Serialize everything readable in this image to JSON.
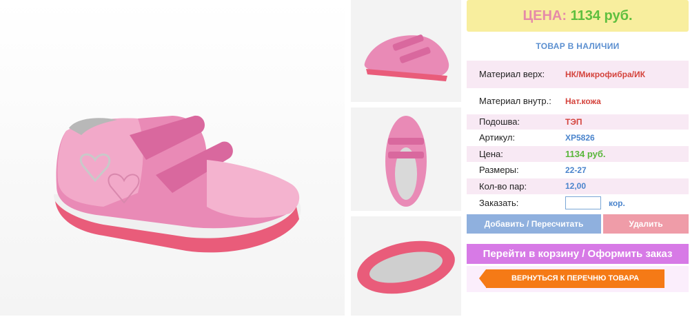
{
  "product": {
    "main_image": "pink-velcro-kids-sneaker-side-view",
    "thumbnails": [
      "sneaker-side-thumbnail",
      "sneaker-top-thumbnail",
      "sneaker-sole-thumbnail"
    ]
  },
  "price_box": {
    "label": "ЦЕНА:",
    "value": "1134 руб."
  },
  "stock_status": "ТОВАР В НАЛИЧИИ",
  "specs": {
    "upper_material": {
      "label": "Материал верх:",
      "value": "НК/Микрофибра/ИК"
    },
    "lining_material": {
      "label": "Материал внутр.:",
      "value": "Нат.кожа"
    },
    "sole": {
      "label": "Подошва:",
      "value": "ТЭП"
    },
    "article": {
      "label": "Артикул:",
      "value": "XP5826"
    },
    "price": {
      "label": "Цена:",
      "value": "1134 руб."
    },
    "sizes": {
      "label": "Размеры:",
      "value": "22-27"
    },
    "pairs": {
      "label": "Кол-во пар:",
      "value": "12,00"
    }
  },
  "order": {
    "label": "Заказать:",
    "value": "",
    "unit": "кор."
  },
  "buttons": {
    "add": "Добавить / Пересчитать",
    "delete": "Удалить",
    "cart": "Перейти в корзину / Оформить заказ",
    "back": "ВЕРНУТЬСЯ К ПЕРЕЧНЮ ТОВАРА"
  },
  "colors": {
    "price_box_bg": "#f8ee9e",
    "price_label": "#e58aa9",
    "price_value": "#5fbf3f",
    "accent_blue": "#4a84cc",
    "accent_red": "#d4433c",
    "cart_bg": "#d77ae6",
    "back_bg": "#f57a16",
    "row_pink": "#f8e9f4"
  }
}
